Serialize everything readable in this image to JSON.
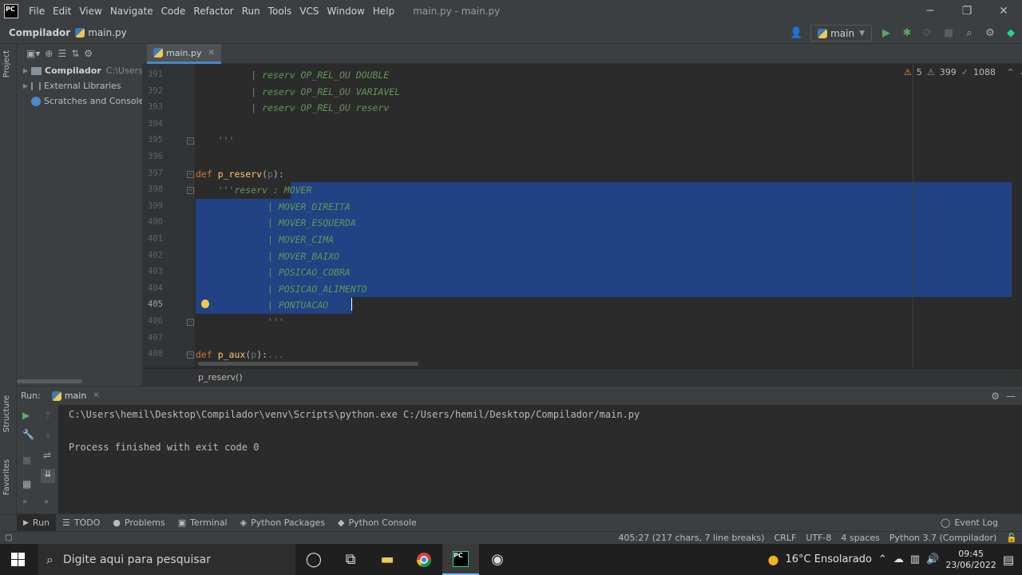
{
  "app": {
    "logo_text": "PC",
    "menu": [
      "File",
      "Edit",
      "View",
      "Navigate",
      "Code",
      "Refactor",
      "Run",
      "Tools",
      "VCS",
      "Window",
      "Help"
    ],
    "window_title": "main.py - main.py"
  },
  "navbar": {
    "project": "Compilador",
    "file": "main.py",
    "run_config": "main"
  },
  "sidebar": {
    "tab_label": "Project",
    "items": [
      {
        "label": "Compilador",
        "path": "C:\\Users\\h"
      },
      {
        "label": "External Libraries"
      },
      {
        "label": "Scratches and Consoles"
      }
    ],
    "structure_label": "Structure",
    "favorites_label": "Favorites"
  },
  "editor": {
    "tab": "main.py",
    "inspections": {
      "warnings": "5",
      "weak_warnings": "399",
      "ok": "1088"
    },
    "lines": [
      {
        "n": "391",
        "parts": [
          [
            "doc",
            "          | reserv OP_REL_OU DOUBLE"
          ]
        ]
      },
      {
        "n": "392",
        "parts": [
          [
            "doc",
            "          | reserv OP_REL_OU VARIAVEL"
          ]
        ]
      },
      {
        "n": "393",
        "parts": [
          [
            "doc",
            "          | reserv OP_REL_OU reserv"
          ]
        ]
      },
      {
        "n": "394",
        "parts": []
      },
      {
        "n": "395",
        "parts": [
          [
            "doc",
            "    '''"
          ]
        ]
      },
      {
        "n": "396",
        "parts": []
      },
      {
        "n": "397",
        "parts": [
          [
            "kw",
            "def "
          ],
          [
            "fn",
            "p_reserv"
          ],
          [
            "txt",
            "("
          ],
          [
            "par",
            "p"
          ],
          [
            "txt",
            "):"
          ]
        ]
      },
      {
        "n": "398",
        "parts": [
          [
            "doc",
            "    '''reserv : MOVER"
          ]
        ]
      },
      {
        "n": "399",
        "parts": [
          [
            "doc",
            "             | MOVER_DIREITA"
          ]
        ]
      },
      {
        "n": "400",
        "parts": [
          [
            "doc",
            "             | MOVER_ESQUERDA"
          ]
        ]
      },
      {
        "n": "401",
        "parts": [
          [
            "doc",
            "             | MOVER_CIMA"
          ]
        ]
      },
      {
        "n": "402",
        "parts": [
          [
            "doc",
            "             | MOVER_BAIXO"
          ]
        ]
      },
      {
        "n": "403",
        "parts": [
          [
            "doc",
            "             | POSICAO_COBRA"
          ]
        ]
      },
      {
        "n": "404",
        "parts": [
          [
            "doc",
            "             | POSICAO_ALIMENTO"
          ]
        ]
      },
      {
        "n": "405",
        "parts": [
          [
            "doc",
            "             | PONTUACAO"
          ]
        ]
      },
      {
        "n": "406",
        "parts": [
          [
            "doc",
            "             '''"
          ]
        ]
      },
      {
        "n": "407",
        "parts": []
      },
      {
        "n": "408",
        "parts": [
          [
            "kw",
            "def "
          ],
          [
            "fn",
            "p_aux"
          ],
          [
            "txt",
            "("
          ],
          [
            "par",
            "p"
          ],
          [
            "txt",
            "):"
          ],
          [
            "par",
            "..."
          ]
        ]
      }
    ],
    "breadcrumb": "p_reserv()"
  },
  "run": {
    "label": "Run:",
    "tab": "main",
    "console": [
      "C:\\Users\\hemil\\Desktop\\Compilador\\venv\\Scripts\\python.exe C:/Users/hemil/Desktop/Compilador/main.py",
      "",
      "Process finished with exit code 0"
    ]
  },
  "bottom_tabs": [
    "Run",
    "TODO",
    "Problems",
    "Terminal",
    "Python Packages",
    "Python Console"
  ],
  "event_log": "Event Log",
  "status": {
    "position": "405:27 (217 chars, 7 line breaks)",
    "line_sep": "CRLF",
    "encoding": "UTF-8",
    "indent": "4 spaces",
    "interpreter": "Python 3.7 (Compilador)"
  },
  "taskbar": {
    "search_placeholder": "Digite aqui para pesquisar",
    "weather": "16°C  Ensolarado",
    "time": "09:45",
    "date": "23/06/2022"
  },
  "colors": {
    "selection": "#214283",
    "keyword": "#cc7832",
    "function": "#ffc66d",
    "docstring": "#629755"
  }
}
